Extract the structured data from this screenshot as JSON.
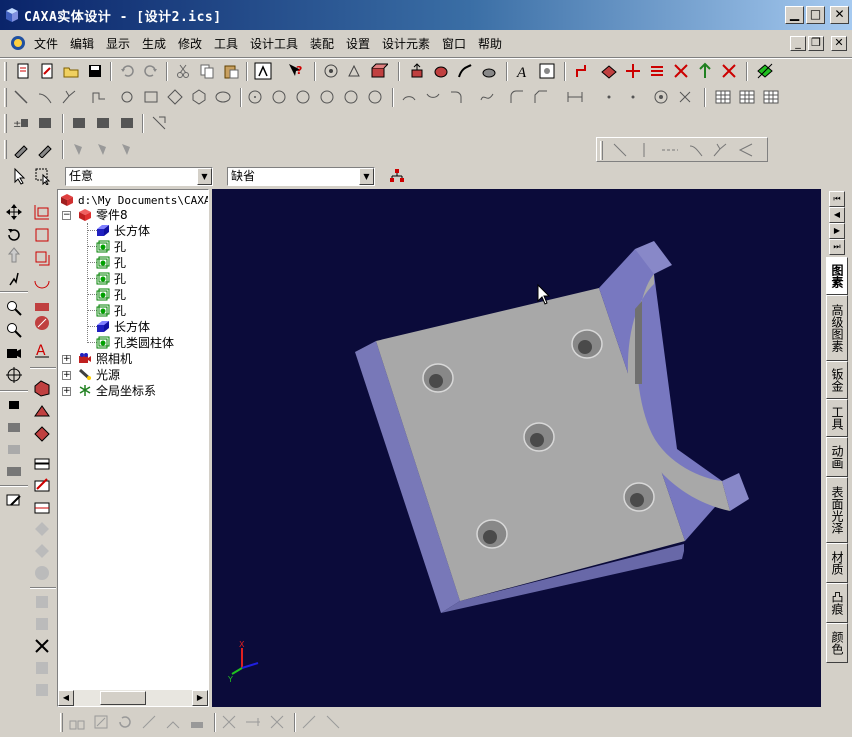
{
  "window": {
    "title": "CAXA实体设计 - [设计2.ics]"
  },
  "menu": [
    "文件",
    "编辑",
    "显示",
    "生成",
    "修改",
    "工具",
    "设计工具",
    "装配",
    "设置",
    "设计元素",
    "窗口",
    "帮助"
  ],
  "combos": {
    "select_filter": "任意",
    "style": "缺省"
  },
  "tree": {
    "root": "d:\\My Documents\\CAXAS",
    "part": "零件8",
    "features": [
      "长方体",
      "孔",
      "孔",
      "孔",
      "孔",
      "孔",
      "长方体",
      "孔类圆柱体"
    ],
    "others": [
      "照相机",
      "光源",
      "全局坐标系"
    ]
  },
  "side_tabs": [
    "图素",
    "高级图素",
    "钣金",
    "工具",
    "动画",
    "表面光泽",
    "材质",
    "凸痕",
    "颜色"
  ],
  "axis": {
    "x": "X",
    "y": "Y"
  },
  "colors": {
    "viewport_bg": "#0b0b3a",
    "part_top": "#a8a8a8",
    "part_side": "#7a7ab8",
    "titlebar": "#0a246a"
  }
}
